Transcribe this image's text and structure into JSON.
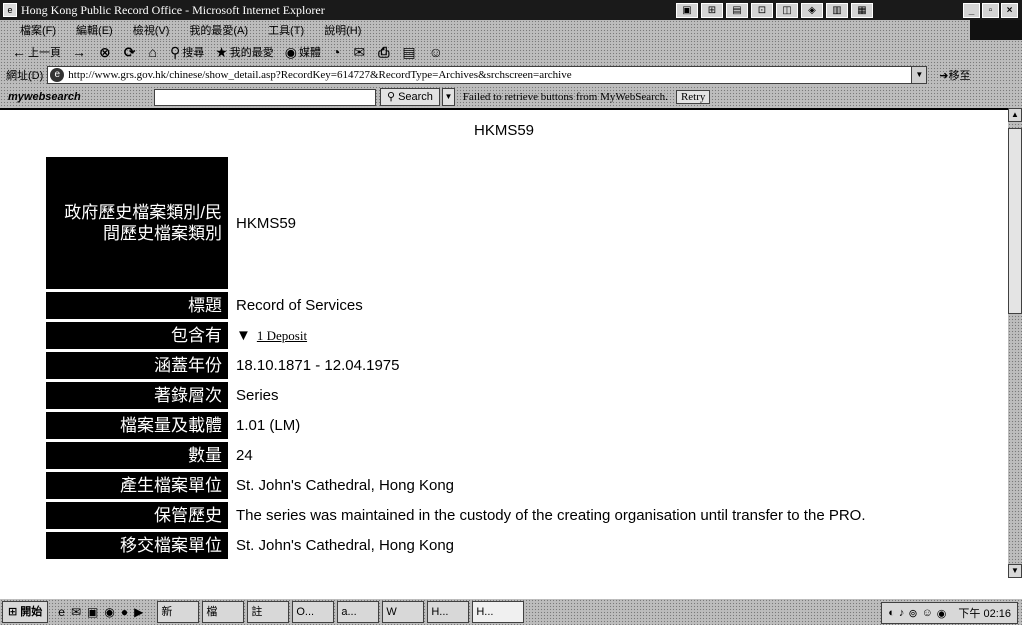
{
  "window": {
    "title": "Hong Kong Public Record Office - Microsoft Internet Explorer"
  },
  "menu": [
    "檔案(F)",
    "編輯(E)",
    "檢視(V)",
    "我的最愛(A)",
    "工具(T)",
    "說明(H)"
  ],
  "toolbar": {
    "back": "上一頁",
    "search": "搜尋",
    "favorites": "我的最愛",
    "media": "媒體"
  },
  "address": {
    "label": "網址(D)",
    "url": "http://www.grs.gov.hk/chinese/show_detail.asp?RecordKey=614727&RecordType=Archives&srchscreen=archive",
    "go": "移至"
  },
  "mywebsearch": {
    "brand": "mywebsearch",
    "search_input": "",
    "search_button": "Search",
    "message": "Failed to retrieve buttons from MyWebSearch.",
    "retry": "Retry"
  },
  "document": {
    "title": "HKMS59",
    "fields": [
      {
        "label": "政府歷史檔案類別/民間歷史檔案類別",
        "value": "HKMS59"
      },
      {
        "label": "標題",
        "value": "Record of Services"
      },
      {
        "label": "包含有",
        "value": "1 Deposit"
      },
      {
        "label": "涵蓋年份",
        "value": "18.10.1871 - 12.04.1975"
      },
      {
        "label": "著錄層次",
        "value": "Series"
      },
      {
        "label": "檔案量及載體",
        "value": "1.01 (LM)"
      },
      {
        "label": "數量",
        "value": "24"
      },
      {
        "label": "產生檔案單位",
        "value": "St. John's Cathedral, Hong Kong"
      },
      {
        "label": "保管歷史",
        "value": "The series was maintained in the custody of the creating organisation until transfer to the PRO."
      },
      {
        "label": "移交檔案單位",
        "value": "St. John's Cathedral, Hong Kong"
      }
    ]
  },
  "taskbar": {
    "start": "開始",
    "tasks": [
      "新",
      "檔",
      "註",
      "O...",
      "a...",
      "W",
      "H...",
      "H..."
    ],
    "clock": "下午 02:16"
  },
  "colors": {
    "title_bar": "#1a1a1a",
    "label_cell": "#000000",
    "chrome": "#bdbdbd"
  },
  "icons": [
    "ie-icon",
    "back-arrow-icon",
    "forward-arrow-icon",
    "stop-icon",
    "refresh-icon",
    "home-icon",
    "search-icon",
    "favorites-icon",
    "media-icon",
    "history-icon",
    "mail-icon",
    "print-icon",
    "edit-icon",
    "messenger-icon"
  ]
}
